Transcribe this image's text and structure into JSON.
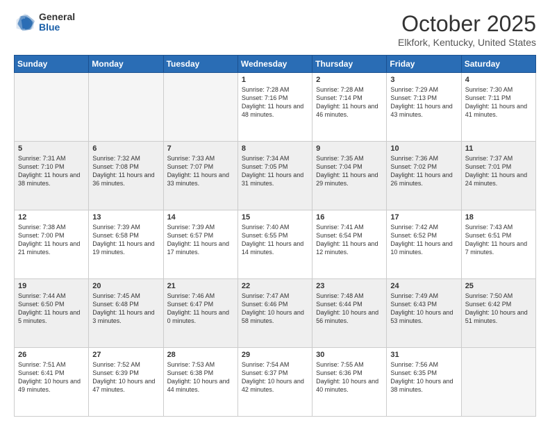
{
  "header": {
    "logo_general": "General",
    "logo_blue": "Blue",
    "month_title": "October 2025",
    "location": "Elkfork, Kentucky, United States"
  },
  "days_of_week": [
    "Sunday",
    "Monday",
    "Tuesday",
    "Wednesday",
    "Thursday",
    "Friday",
    "Saturday"
  ],
  "weeks": [
    {
      "shaded": false,
      "days": [
        {
          "num": "",
          "empty": true
        },
        {
          "num": "",
          "empty": true
        },
        {
          "num": "",
          "empty": true
        },
        {
          "num": "1",
          "sunrise": "7:28 AM",
          "sunset": "7:16 PM",
          "daylight": "11 hours and 48 minutes."
        },
        {
          "num": "2",
          "sunrise": "7:28 AM",
          "sunset": "7:14 PM",
          "daylight": "11 hours and 46 minutes."
        },
        {
          "num": "3",
          "sunrise": "7:29 AM",
          "sunset": "7:13 PM",
          "daylight": "11 hours and 43 minutes."
        },
        {
          "num": "4",
          "sunrise": "7:30 AM",
          "sunset": "7:11 PM",
          "daylight": "11 hours and 41 minutes."
        }
      ]
    },
    {
      "shaded": true,
      "days": [
        {
          "num": "5",
          "sunrise": "7:31 AM",
          "sunset": "7:10 PM",
          "daylight": "11 hours and 38 minutes."
        },
        {
          "num": "6",
          "sunrise": "7:32 AM",
          "sunset": "7:08 PM",
          "daylight": "11 hours and 36 minutes."
        },
        {
          "num": "7",
          "sunrise": "7:33 AM",
          "sunset": "7:07 PM",
          "daylight": "11 hours and 33 minutes."
        },
        {
          "num": "8",
          "sunrise": "7:34 AM",
          "sunset": "7:05 PM",
          "daylight": "11 hours and 31 minutes."
        },
        {
          "num": "9",
          "sunrise": "7:35 AM",
          "sunset": "7:04 PM",
          "daylight": "11 hours and 29 minutes."
        },
        {
          "num": "10",
          "sunrise": "7:36 AM",
          "sunset": "7:02 PM",
          "daylight": "11 hours and 26 minutes."
        },
        {
          "num": "11",
          "sunrise": "7:37 AM",
          "sunset": "7:01 PM",
          "daylight": "11 hours and 24 minutes."
        }
      ]
    },
    {
      "shaded": false,
      "days": [
        {
          "num": "12",
          "sunrise": "7:38 AM",
          "sunset": "7:00 PM",
          "daylight": "11 hours and 21 minutes."
        },
        {
          "num": "13",
          "sunrise": "7:39 AM",
          "sunset": "6:58 PM",
          "daylight": "11 hours and 19 minutes."
        },
        {
          "num": "14",
          "sunrise": "7:39 AM",
          "sunset": "6:57 PM",
          "daylight": "11 hours and 17 minutes."
        },
        {
          "num": "15",
          "sunrise": "7:40 AM",
          "sunset": "6:55 PM",
          "daylight": "11 hours and 14 minutes."
        },
        {
          "num": "16",
          "sunrise": "7:41 AM",
          "sunset": "6:54 PM",
          "daylight": "11 hours and 12 minutes."
        },
        {
          "num": "17",
          "sunrise": "7:42 AM",
          "sunset": "6:52 PM",
          "daylight": "11 hours and 10 minutes."
        },
        {
          "num": "18",
          "sunrise": "7:43 AM",
          "sunset": "6:51 PM",
          "daylight": "11 hours and 7 minutes."
        }
      ]
    },
    {
      "shaded": true,
      "days": [
        {
          "num": "19",
          "sunrise": "7:44 AM",
          "sunset": "6:50 PM",
          "daylight": "11 hours and 5 minutes."
        },
        {
          "num": "20",
          "sunrise": "7:45 AM",
          "sunset": "6:48 PM",
          "daylight": "11 hours and 3 minutes."
        },
        {
          "num": "21",
          "sunrise": "7:46 AM",
          "sunset": "6:47 PM",
          "daylight": "11 hours and 0 minutes."
        },
        {
          "num": "22",
          "sunrise": "7:47 AM",
          "sunset": "6:46 PM",
          "daylight": "10 hours and 58 minutes."
        },
        {
          "num": "23",
          "sunrise": "7:48 AM",
          "sunset": "6:44 PM",
          "daylight": "10 hours and 56 minutes."
        },
        {
          "num": "24",
          "sunrise": "7:49 AM",
          "sunset": "6:43 PM",
          "daylight": "10 hours and 53 minutes."
        },
        {
          "num": "25",
          "sunrise": "7:50 AM",
          "sunset": "6:42 PM",
          "daylight": "10 hours and 51 minutes."
        }
      ]
    },
    {
      "shaded": false,
      "days": [
        {
          "num": "26",
          "sunrise": "7:51 AM",
          "sunset": "6:41 PM",
          "daylight": "10 hours and 49 minutes."
        },
        {
          "num": "27",
          "sunrise": "7:52 AM",
          "sunset": "6:39 PM",
          "daylight": "10 hours and 47 minutes."
        },
        {
          "num": "28",
          "sunrise": "7:53 AM",
          "sunset": "6:38 PM",
          "daylight": "10 hours and 44 minutes."
        },
        {
          "num": "29",
          "sunrise": "7:54 AM",
          "sunset": "6:37 PM",
          "daylight": "10 hours and 42 minutes."
        },
        {
          "num": "30",
          "sunrise": "7:55 AM",
          "sunset": "6:36 PM",
          "daylight": "10 hours and 40 minutes."
        },
        {
          "num": "31",
          "sunrise": "7:56 AM",
          "sunset": "6:35 PM",
          "daylight": "10 hours and 38 minutes."
        },
        {
          "num": "",
          "empty": true
        }
      ]
    }
  ],
  "labels": {
    "sunrise": "Sunrise:",
    "sunset": "Sunset:",
    "daylight": "Daylight:"
  }
}
